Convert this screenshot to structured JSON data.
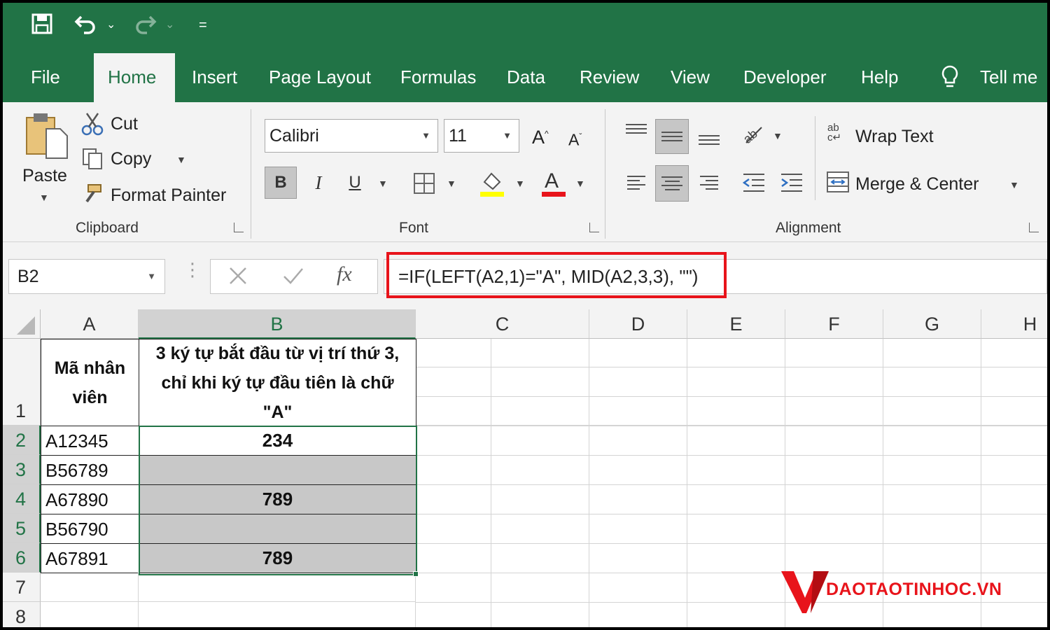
{
  "qat": {
    "undo_dd": "⌄",
    "redo_dd": "⌄",
    "customize": "="
  },
  "tabs": [
    "File",
    "Home",
    "Insert",
    "Page Layout",
    "Formulas",
    "Data",
    "Review",
    "View",
    "Developer",
    "Help"
  ],
  "tell_me": "Tell me",
  "clipboard": {
    "paste": "Paste",
    "cut": "Cut",
    "copy": "Copy",
    "format_painter": "Format Painter",
    "group": "Clipboard"
  },
  "font": {
    "name": "Calibri",
    "size": "11",
    "group": "Font",
    "bold": "B",
    "italic": "I",
    "underline": "U"
  },
  "alignment": {
    "wrap": "Wrap Text",
    "merge": "Merge & Center",
    "group": "Alignment"
  },
  "formula_bar": {
    "name_box": "B2",
    "fx": "fx",
    "formula": "=IF(LEFT(A2,1)=\"A\", MID(A2,3,3), \"\")"
  },
  "columns": [
    "A",
    "B",
    "C",
    "D",
    "E",
    "F",
    "G",
    "H"
  ],
  "rows": [
    "1",
    "2",
    "3",
    "4",
    "5",
    "6",
    "7",
    "8"
  ],
  "table": {
    "header_a": "Mã nhân viên",
    "header_b": "3 ký tự bắt đầu từ vị trí thứ 3, chỉ khi ký tự đầu tiên là chữ \"A\"",
    "codes": [
      "A12345",
      "B56789",
      "A67890",
      "B56790",
      "A67891"
    ],
    "results": [
      "234",
      "",
      "789",
      "",
      "789"
    ]
  },
  "watermark": "DAOTAOTINHOC.VN",
  "colors": {
    "excel_green": "#217346",
    "highlight_red": "#e8141b",
    "selection_shade": "#c8c8c8"
  }
}
